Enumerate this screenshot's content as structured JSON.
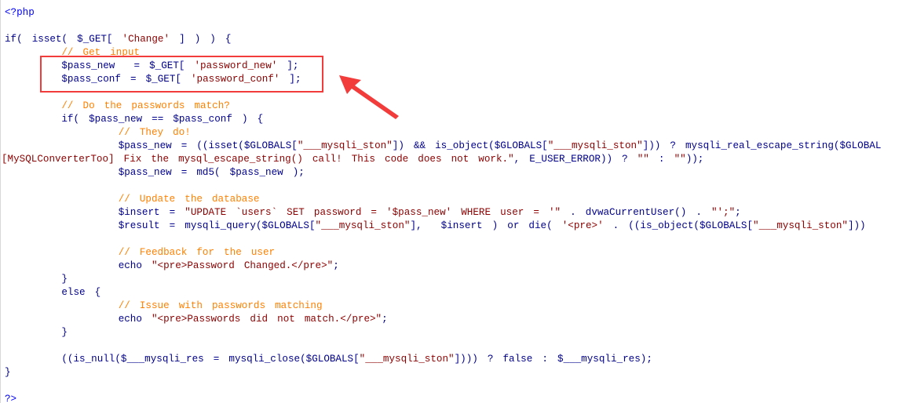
{
  "editor": {
    "lines": [
      [
        {
          "t": "<?php",
          "c": "php"
        }
      ],
      [],
      [
        {
          "t": "if( ",
          "c": "kw"
        },
        {
          "t": "isset( ",
          "c": "fn"
        },
        {
          "t": "$_GET[ ",
          "c": "var"
        },
        {
          "t": "'Change'",
          "c": "str"
        },
        {
          "t": " ] ) ) {",
          "c": "op"
        }
      ],
      [
        {
          "t": "      // Get input",
          "c": "cm"
        }
      ],
      [
        {
          "t": "      $pass_new  = $_GET[ ",
          "c": "var"
        },
        {
          "t": "'password_new'",
          "c": "str"
        },
        {
          "t": " ];",
          "c": "op"
        }
      ],
      [
        {
          "t": "      $pass_conf = $_GET[ ",
          "c": "var"
        },
        {
          "t": "'password_conf'",
          "c": "str"
        },
        {
          "t": " ];",
          "c": "op"
        }
      ],
      [],
      [
        {
          "t": "      // Do the passwords match?",
          "c": "cm"
        }
      ],
      [
        {
          "t": "      if( $pass_new == $pass_conf ) {",
          "c": "kw"
        }
      ],
      [
        {
          "t": "            // They do!",
          "c": "cm"
        }
      ],
      [
        {
          "t": "            $pass_new = ((isset($GLOBALS[",
          "c": "var"
        },
        {
          "t": "\"___mysqli_ston\"",
          "c": "str"
        },
        {
          "t": "]) && is_object($GLOBALS[",
          "c": "var"
        },
        {
          "t": "\"___mysqli_ston\"",
          "c": "str"
        },
        {
          "t": "])) ? mysqli_real_escape_string($GLOBAL",
          "c": "fn"
        }
      ],
      [
        {
          "t": "[MySQLConverterToo] Fix the mysql_escape_string() call! This code does not work.\"",
          "c": "err"
        },
        {
          "t": ", E_USER_ERROR)) ? ",
          "c": "op"
        },
        {
          "t": "\"\"",
          "c": "str"
        },
        {
          "t": " : ",
          "c": "op"
        },
        {
          "t": "\"\"",
          "c": "str"
        },
        {
          "t": "));",
          "c": "op"
        }
      ],
      [
        {
          "t": "            $pass_new = md5( $pass_new );",
          "c": "fn"
        }
      ],
      [],
      [
        {
          "t": "            // Update the database",
          "c": "cm"
        }
      ],
      [
        {
          "t": "            $insert = ",
          "c": "var"
        },
        {
          "t": "\"UPDATE `users` SET password = '$pass_new' WHERE user = '\"",
          "c": "str"
        },
        {
          "t": " . dvwaCurrentUser() . ",
          "c": "fn"
        },
        {
          "t": "\"';\"",
          "c": "str"
        },
        {
          "t": ";",
          "c": "op"
        }
      ],
      [
        {
          "t": "            $result = mysqli_query($GLOBALS[",
          "c": "fn"
        },
        {
          "t": "\"___mysqli_ston\"",
          "c": "str"
        },
        {
          "t": "],  $insert ) or die( ",
          "c": "fn"
        },
        {
          "t": "'<pre>'",
          "c": "str"
        },
        {
          "t": " . ((is_object($GLOBALS[",
          "c": "fn"
        },
        {
          "t": "\"___mysqli_ston\"",
          "c": "str"
        },
        {
          "t": "]))",
          "c": "op"
        }
      ],
      [],
      [
        {
          "t": "            // Feedback for the user",
          "c": "cm"
        }
      ],
      [
        {
          "t": "            echo ",
          "c": "kw"
        },
        {
          "t": "\"<pre>Password Changed.</pre>\"",
          "c": "str"
        },
        {
          "t": ";",
          "c": "op"
        }
      ],
      [
        {
          "t": "      }",
          "c": "op"
        }
      ],
      [
        {
          "t": "      else {",
          "c": "kw"
        }
      ],
      [
        {
          "t": "            // Issue with passwords matching",
          "c": "cm"
        }
      ],
      [
        {
          "t": "            echo ",
          "c": "kw"
        },
        {
          "t": "\"<pre>Passwords did not match.</pre>\"",
          "c": "str"
        },
        {
          "t": ";",
          "c": "op"
        }
      ],
      [
        {
          "t": "      }",
          "c": "op"
        }
      ],
      [],
      [
        {
          "t": "      ((is_null($___mysqli_res = mysqli_close($GLOBALS[",
          "c": "fn"
        },
        {
          "t": "\"___mysqli_ston\"",
          "c": "str"
        },
        {
          "t": "]))) ? false : $___mysqli_res);",
          "c": "fn"
        }
      ],
      [
        {
          "t": "}",
          "c": "op"
        }
      ],
      [],
      [
        {
          "t": "?>",
          "c": "php"
        }
      ]
    ]
  },
  "annotation": {
    "box_color": "#f23c3c",
    "arrow_color": "#f23c3c"
  }
}
